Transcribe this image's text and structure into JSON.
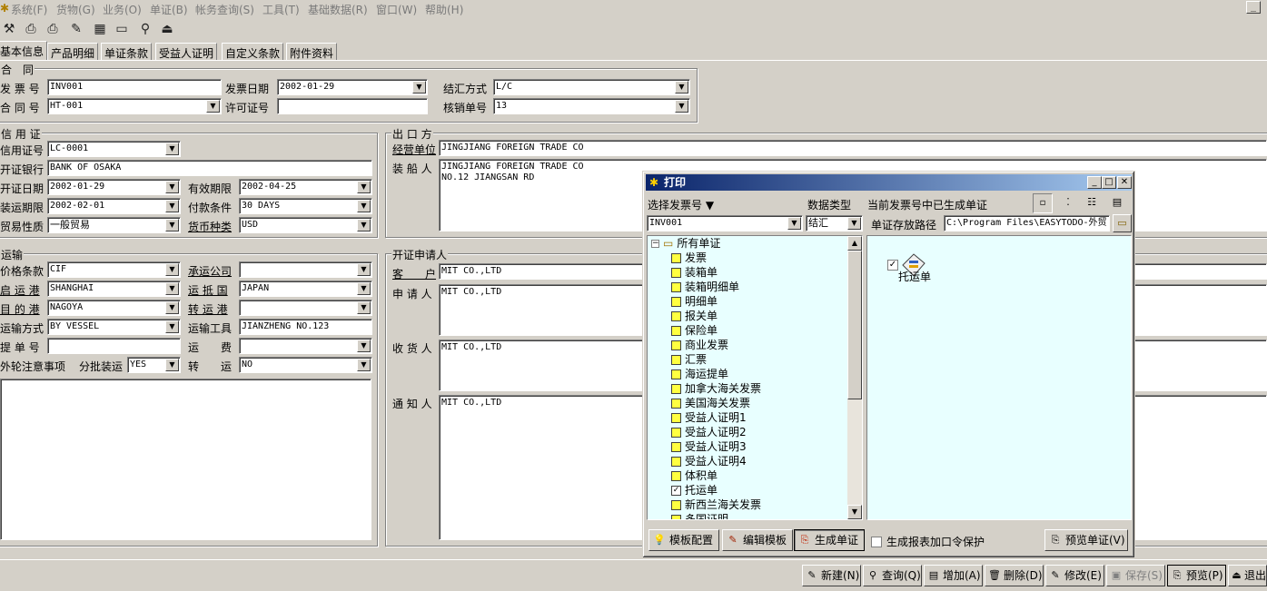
{
  "menu": [
    "系统(F)",
    "货物(G)",
    "业务(O)",
    "单证(B)",
    "帐务查询(S)",
    "工具(T)",
    "基础数据(R)",
    "窗口(W)",
    "帮助(H)"
  ],
  "tabs": [
    "基本信息",
    "产品明细",
    "单证条款",
    "受益人证明",
    "自定义条款",
    "附件资料"
  ],
  "contract": {
    "group": "合　同",
    "invoice_no_label": "发 票 号",
    "invoice_no": "INV001",
    "invoice_date_label": "发票日期",
    "invoice_date": "2002-01-29",
    "settle_label": "结汇方式",
    "settle": "L/C",
    "contract_no_label": "合 同 号",
    "contract_no": "HT-001",
    "license_label": "许可证号",
    "license": "",
    "verify_label": "核销单号",
    "verify": "13"
  },
  "credit": {
    "group": "信 用 证",
    "lc_no_label": "信用证号",
    "lc_no": "LC-0001",
    "bank_label": "开证银行",
    "bank": "BANK OF OSAKA",
    "open_date_label": "开证日期",
    "open_date": "2002-01-29",
    "valid_label": "有效期限",
    "valid": "2002-04-25",
    "ship_limit_label": "装运期限",
    "ship_limit": "2002-02-01",
    "pay_label": "付款条件",
    "pay": "30 DAYS",
    "trade_label": "贸易性质",
    "trade": "一般贸易",
    "currency_label": "货币种类",
    "currency": "USD"
  },
  "transport": {
    "group": "运输",
    "price_label": "价格条款",
    "price": "CIF",
    "carrier_label": "承运公司",
    "carrier": "",
    "from_label": "启 运 港",
    "from": "SHANGHAI",
    "dest_country_label": "运 抵 国",
    "dest_country": "JAPAN",
    "dest_label": "目 的 港",
    "dest": "NAGOYA",
    "transfer_label": "转 运 港",
    "transfer": "",
    "mode_label": "运输方式",
    "mode": "BY VESSEL",
    "tool_label": "运输工具",
    "tool": "JIANZHENG NO.123",
    "bl_label": "提 单 号",
    "bl": "",
    "freight_label": "运　　费",
    "freight": "",
    "notes_label": "外轮注意事项",
    "partial_label": "分批装运",
    "partial": "YES",
    "trans_label": "转　　运",
    "trans": "NO"
  },
  "exporter": {
    "group": "出 口 方",
    "unit_label": "经营单位",
    "unit": "JINGJIANG FOREIGN TRADE CO",
    "shipper_label": "装 船 人",
    "shipper": "JINGJIANG FOREIGN TRADE CO\nNO.12 JIANGSAN RD"
  },
  "applicant": {
    "group": "开证申请人",
    "customer_label": "客　　户",
    "customer": "MIT CO.,LTD",
    "applicant_label": "申 请 人",
    "applicant": "MIT CO.,LTD",
    "consignee_label": "收 货 人",
    "consignee": "MIT CO.,LTD",
    "notify_label": "通 知 人",
    "notify": "MIT CO.,LTD"
  },
  "print_dialog": {
    "title": "打印",
    "select_invoice_label": "选择发票号",
    "data_type_label": "数据类型",
    "generated_label": "当前发票号中已生成单证",
    "invoice_value": "INV001",
    "data_type_value": "结汇",
    "path_label": "单证存放路径",
    "path_value": "C:\\Program Files\\EASYTODO-外贸",
    "tree_root": "所有单证",
    "tree_items": [
      {
        "label": "发票",
        "checked": false
      },
      {
        "label": "装箱单",
        "checked": false
      },
      {
        "label": "装箱明细单",
        "checked": false
      },
      {
        "label": "明细单",
        "checked": false
      },
      {
        "label": "报关单",
        "checked": false
      },
      {
        "label": "保险单",
        "checked": false
      },
      {
        "label": "商业发票",
        "checked": false
      },
      {
        "label": "汇票",
        "checked": false
      },
      {
        "label": "海运提单",
        "checked": false
      },
      {
        "label": "加拿大海关发票",
        "checked": false
      },
      {
        "label": "美国海关发票",
        "checked": false
      },
      {
        "label": "受益人证明1",
        "checked": false
      },
      {
        "label": "受益人证明2",
        "checked": false
      },
      {
        "label": "受益人证明3",
        "checked": false
      },
      {
        "label": "受益人证明4",
        "checked": false
      },
      {
        "label": "体积单",
        "checked": false
      },
      {
        "label": "托运单",
        "checked": true
      },
      {
        "label": "新西兰海关发票",
        "checked": false
      },
      {
        "label": "多国证明",
        "checked": false
      }
    ],
    "generated_doc": "托运单",
    "btn_template_config": "模板配置",
    "btn_edit_template": "编辑模板",
    "btn_generate": "生成单证",
    "password_protect_label": "生成报表加口令保护",
    "btn_preview_doc": "预览单证(V)"
  },
  "bottom_buttons": [
    "新建(N)",
    "查询(Q)",
    "增加(A)",
    "删除(D)",
    "修改(E)",
    "保存(S)",
    "预览(P)",
    "退出"
  ]
}
